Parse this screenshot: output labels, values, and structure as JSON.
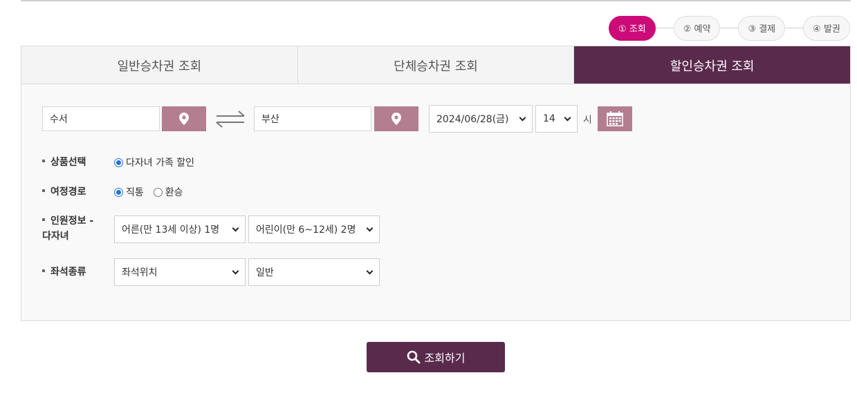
{
  "steps": [
    {
      "label": "① 조회",
      "active": true
    },
    {
      "label": "② 예약",
      "active": false
    },
    {
      "label": "③ 결제",
      "active": false
    },
    {
      "label": "④ 발권",
      "active": false
    }
  ],
  "tabs": [
    {
      "label": "일반승차권 조회",
      "active": false
    },
    {
      "label": "단체승차권 조회",
      "active": false
    },
    {
      "label": "할인승차권 조회",
      "active": true
    }
  ],
  "route": {
    "departure": "수서",
    "arrival": "부산",
    "date": "2024/06/28(금)",
    "hour": "14",
    "hour_unit": "시"
  },
  "form": {
    "product_label": "상품선택",
    "product_option": "다자녀 가족 할인",
    "trip_label": "여정경로",
    "trip_options": [
      "직통",
      "환승"
    ],
    "people_label_line1": "인원정보 -",
    "people_label_line2": "다자녀",
    "adult_select": "어른(만 13세 이상) 1명",
    "child_select": "어린이(만 6~12세) 2명",
    "seat_label": "좌석종류",
    "seat_position_select": "좌석위치",
    "seat_class_select": "일반"
  },
  "search_button": "조회하기",
  "colors": {
    "accent_magenta": "#cc0b78",
    "tab_active": "#5a2a4d",
    "icon_button": "#b37e8f"
  }
}
